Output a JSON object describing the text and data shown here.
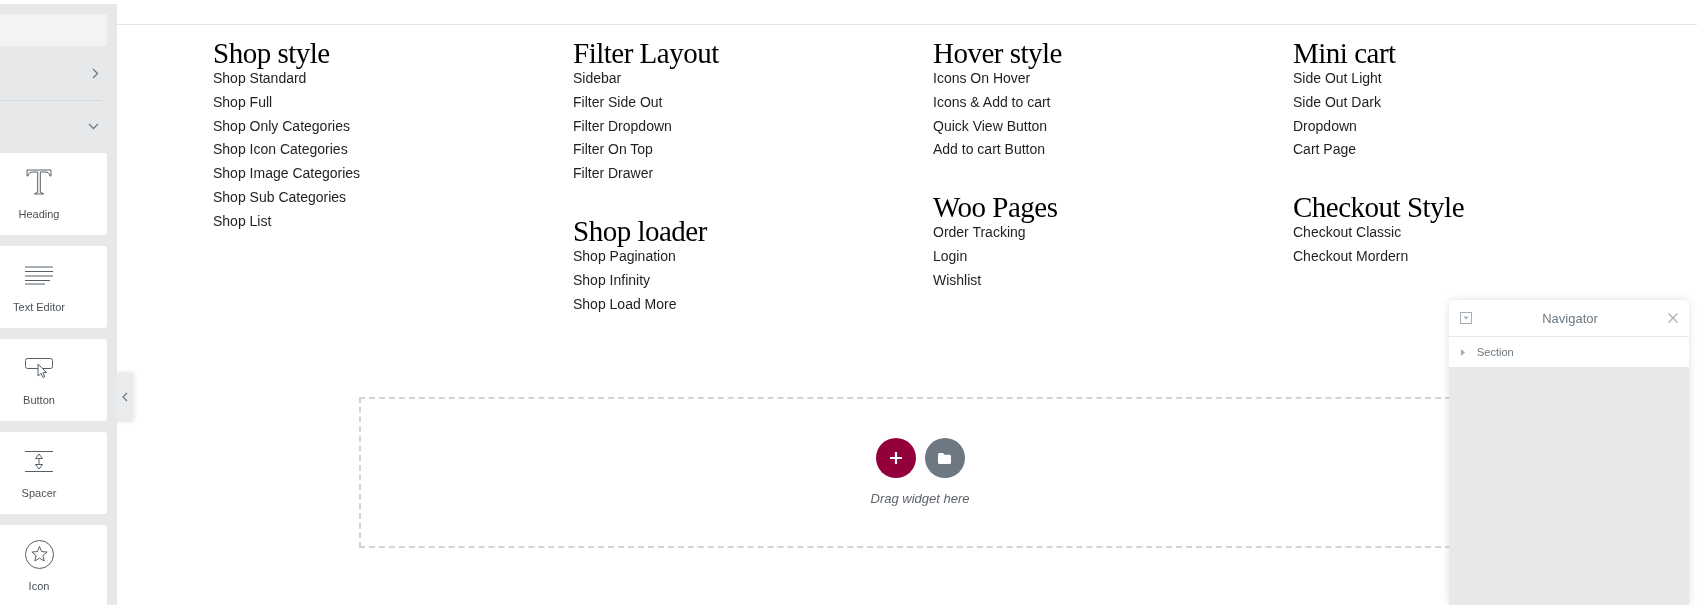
{
  "sidebar": {
    "categories": [
      {
        "expanded": false
      },
      {
        "expanded": true,
        "widgets": [
          {
            "kind": "heading",
            "label": "Heading"
          },
          {
            "kind": "texteditor",
            "label": "Text Editor"
          },
          {
            "kind": "button",
            "label": "Button"
          },
          {
            "kind": "spacer",
            "label": "Spacer"
          },
          {
            "kind": "icon",
            "label": "Icon"
          }
        ]
      }
    ]
  },
  "menu": {
    "columns": [
      {
        "groups": [
          {
            "title": "Shop style",
            "links": [
              "Shop Standard",
              "Shop Full",
              "Shop Only Categories",
              "Shop Icon Categories",
              "Shop Image Categories",
              "Shop Sub Categories",
              "Shop List"
            ]
          }
        ]
      },
      {
        "groups": [
          {
            "title": "Filter Layout",
            "links": [
              "Sidebar",
              "Filter Side Out",
              "Filter Dropdown",
              "Filter On Top",
              "Filter Drawer"
            ]
          },
          {
            "title": "Shop loader",
            "links": [
              "Shop Pagination",
              "Shop Infinity",
              "Shop Load More"
            ]
          }
        ]
      },
      {
        "groups": [
          {
            "title": "Hover style",
            "links": [
              "Icons On Hover",
              "Icons & Add to cart",
              "Quick View Button",
              "Add to cart Button"
            ]
          },
          {
            "title": "Woo Pages",
            "links": [
              "Order Tracking",
              "Login",
              "Wishlist"
            ]
          }
        ]
      },
      {
        "groups": [
          {
            "title": "Mini cart",
            "links": [
              "Side Out Light",
              "Side Out Dark",
              "Dropdown",
              "Cart Page"
            ]
          },
          {
            "title": "Checkout Style",
            "links": [
              "Checkout Classic",
              "Checkout Mordern"
            ]
          }
        ]
      }
    ]
  },
  "drop_zone": {
    "hint": "Drag widget here"
  },
  "navigator": {
    "title": "Navigator",
    "tree": [
      {
        "label": "Section",
        "expanded": false
      }
    ]
  }
}
